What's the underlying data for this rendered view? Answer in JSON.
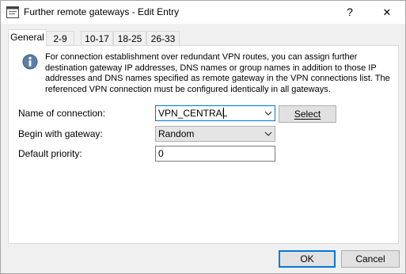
{
  "window": {
    "title": "Further remote gateways - Edit Entry",
    "help_glyph": "?",
    "close_glyph": "✕"
  },
  "tabs": [
    {
      "label": "General",
      "active": true
    },
    {
      "label": "2-9",
      "active": false
    },
    {
      "label": "10-17",
      "active": false
    },
    {
      "label": "18-25",
      "active": false
    },
    {
      "label": "26-33",
      "active": false
    }
  ],
  "info": {
    "text": "For connection establishment over redundant VPN routes, you can assign further destination gateway IP addresses, DNS names or group names in addition to those IP addresses and DNS names specified as remote gateway in the VPN connections list. The referenced VPN connection must be configured identically in all gateways."
  },
  "form": {
    "connection_label": "Name of connection:",
    "connection_value": "VPN_CENTRAL",
    "select_label": "Select",
    "gateway_label": "Begin with gateway:",
    "gateway_value": "Random",
    "priority_label": "Default priority:",
    "priority_value": "0"
  },
  "footer": {
    "ok_label": "OK",
    "cancel_label": "Cancel"
  },
  "colors": {
    "accent": "#0078d7",
    "info_icon": "#5b7fa6"
  }
}
